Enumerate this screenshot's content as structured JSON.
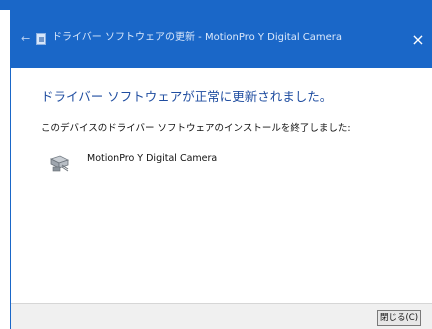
{
  "window": {
    "title": "ドライバー ソフトウェアの更新 - MotionPro Y Digital Camera",
    "back_icon": "←",
    "close_icon": "×",
    "icon_name": "device-manager-icon",
    "accent": "#1a67c8"
  },
  "content": {
    "heading": "ドライバー ソフトウェアが正常に更新されました。",
    "subtext": "このデバイスのドライバー ソフトウェアのインストールを終了しました:",
    "device_name": "MotionPro Y Digital Camera",
    "device_icon": "camera-device-icon"
  },
  "footer": {
    "close_label": "閉じる(C)"
  }
}
